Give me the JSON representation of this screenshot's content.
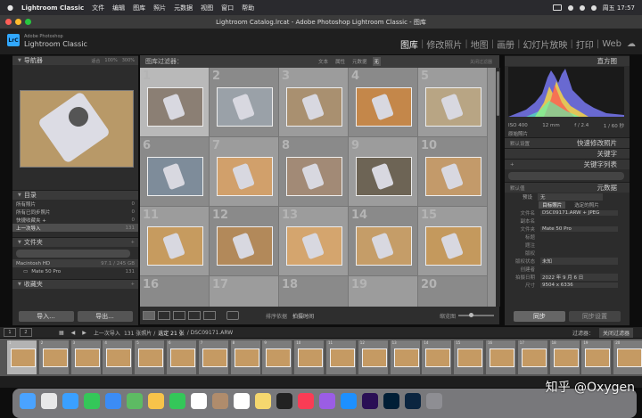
{
  "menubar": {
    "apple": "",
    "app": "Lightroom Classic",
    "items": [
      "文件",
      "编辑",
      "图库",
      "照片",
      "元数据",
      "视图",
      "窗口",
      "帮助"
    ],
    "datetime": "周五 17:57"
  },
  "window": {
    "title": "Lightroom Catalog.lrcat - Adobe Photoshop Lightroom Classic - 图库"
  },
  "identity": {
    "logo": "LrC",
    "brand_top": "Adobe Photoshop",
    "brand_bottom": "Lightroom Classic"
  },
  "modules": [
    "图库",
    "修改照片",
    "地图",
    "画册",
    "幻灯片放映",
    "打印",
    "Web"
  ],
  "active_module": "图库",
  "left": {
    "navigator": {
      "title": "导航器",
      "zoom_options": [
        "适合",
        "100%",
        "300%"
      ]
    },
    "catalog": {
      "title": "目录",
      "items": [
        {
          "label": "所有照片",
          "count": "0"
        },
        {
          "label": "所有已同步照片",
          "count": "0"
        },
        {
          "label": "快捷收藏夹 +",
          "count": "0"
        },
        {
          "label": "上一次导入",
          "count": "131"
        }
      ]
    },
    "folders": {
      "title": "文件夹",
      "search_placeholder": "",
      "volume": "Macintosh HD",
      "volume_info": "97.1 / 245 GB",
      "folder": "Mate 50 Pro",
      "folder_count": "131"
    },
    "collections": {
      "title": "收藏夹"
    },
    "import_label": "导入...",
    "export_label": "导出..."
  },
  "filter": {
    "title": "图库过滤器：",
    "tabs": [
      "文本",
      "属性",
      "元数据",
      "无"
    ],
    "active_tab": "无",
    "lock": "关闭过滤器"
  },
  "grid": {
    "numbers": [
      "1",
      "2",
      "3",
      "4",
      "5",
      "6",
      "7",
      "8",
      "9",
      "10",
      "11",
      "12",
      "13",
      "14",
      "15",
      "16",
      "17",
      "18",
      "19",
      "20"
    ],
    "selected_index": 0
  },
  "toolbar": {
    "sort_label": "排序依据",
    "sort_value": "拍摄时间",
    "thumb_label": "缩览图"
  },
  "right": {
    "histogram": {
      "title": "直方图",
      "iso": "ISO 400",
      "focal": "12 mm",
      "aperture": "f / 2.4",
      "shutter": "1 / 60 秒",
      "original": "原始照片"
    },
    "quick_develop": {
      "title": "快速修改照片",
      "preset": "默认设置"
    },
    "keywords": {
      "title": "关键字"
    },
    "keyword_list": {
      "title": "关键字列表"
    },
    "metadata": {
      "title": "元数据",
      "preset_label": "默认值",
      "preset_value": "无",
      "target": "目标照片",
      "selected": "选定的照片",
      "fields": [
        {
          "label": "文件名",
          "value": "DSC09171.ARW + JPEG"
        },
        {
          "label": "副本名",
          "value": ""
        },
        {
          "label": "文件夹",
          "value": "Mate 50 Pro"
        },
        {
          "label": "标题",
          "value": ""
        },
        {
          "label": "题注",
          "value": ""
        },
        {
          "label": "版权",
          "value": ""
        },
        {
          "label": "版权状态",
          "value": "未知"
        },
        {
          "label": "创建者",
          "value": ""
        },
        {
          "label": "拍摄日期",
          "value": "2022 年 9 月 6 日"
        },
        {
          "label": "尺寸",
          "value": "9504 x 6336"
        }
      ]
    },
    "sync_label": "同步",
    "sync_settings_label": "同步设置"
  },
  "filmstrip": {
    "pages": [
      "1",
      "2"
    ],
    "source": "上一次导入",
    "count_text": "131 张照片 /",
    "selected_text": "选定 21 张",
    "file": "/ DSC09171.ARW",
    "filter_label": "过滤器：",
    "filter_value": "关闭过滤器",
    "numbers": [
      "1",
      "2",
      "3",
      "4",
      "5",
      "6",
      "7",
      "8",
      "9",
      "10",
      "11",
      "12",
      "13",
      "14",
      "15",
      "16",
      "17",
      "18",
      "19",
      "20"
    ]
  },
  "watermark": "知乎 @Oxygen",
  "dock": [
    "finder",
    "launchpad",
    "safari",
    "messages",
    "mail",
    "maps",
    "photos",
    "facetime",
    "calendar",
    "contacts",
    "reminders",
    "notes",
    "tv",
    "music",
    "podcasts",
    "app-store",
    "premiere",
    "photoshop",
    "lightroom",
    "settings"
  ]
}
